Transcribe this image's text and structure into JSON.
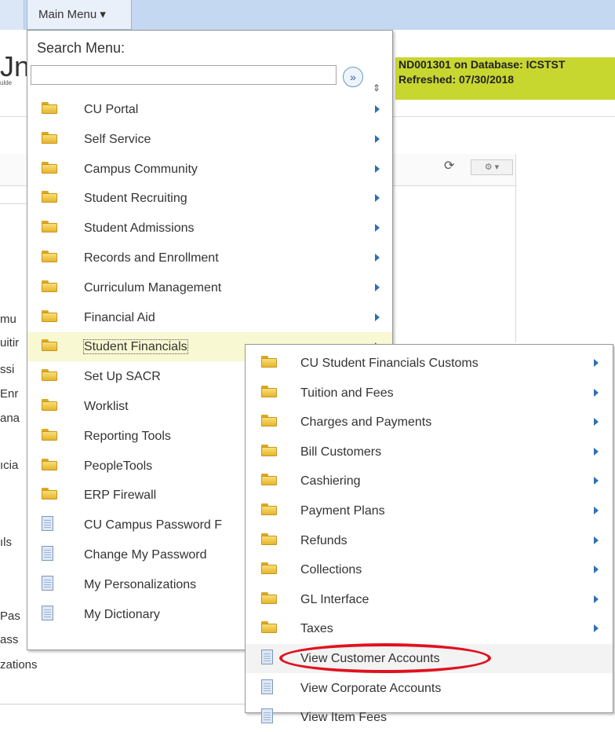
{
  "topbar": {
    "main_menu_label": "Main Menu ▾"
  },
  "background": {
    "title_fragment": "Jn",
    "subtitle_fragment": "ulde",
    "env_line1": "ND001301 on Database: ICSTST",
    "env_line2": "Refreshed: 07/30/2018",
    "refresh_icon": "⟳",
    "gear_icon": "⚙ ▾",
    "left_fragments": [
      "mu",
      "uitir",
      "ssi",
      "Enr",
      "ana",
      "ıcia",
      "",
      "ıls",
      "Pas",
      "ass",
      "zations"
    ]
  },
  "menu": {
    "search_label": "Search Menu:",
    "search_value": "",
    "go_icon": "»",
    "sort_icon": "⇕",
    "items": [
      {
        "label": "CU Portal",
        "icon": "folder",
        "arrow": true
      },
      {
        "label": "Self Service",
        "icon": "folder",
        "arrow": true
      },
      {
        "label": "Campus Community",
        "icon": "folder",
        "arrow": true
      },
      {
        "label": "Student Recruiting",
        "icon": "folder",
        "arrow": true
      },
      {
        "label": "Student Admissions",
        "icon": "folder",
        "arrow": true
      },
      {
        "label": "Records and Enrollment",
        "icon": "folder",
        "arrow": true
      },
      {
        "label": "Curriculum Management",
        "icon": "folder",
        "arrow": true
      },
      {
        "label": "Financial Aid",
        "icon": "folder",
        "arrow": true
      },
      {
        "label": "Student Financials",
        "icon": "folder",
        "arrow": true,
        "selected": true
      },
      {
        "label": "Set Up SACR",
        "icon": "folder",
        "arrow": false
      },
      {
        "label": "Worklist",
        "icon": "folder",
        "arrow": false
      },
      {
        "label": "Reporting Tools",
        "icon": "folder",
        "arrow": false
      },
      {
        "label": "PeopleTools",
        "icon": "folder",
        "arrow": false
      },
      {
        "label": "ERP Firewall",
        "icon": "folder",
        "arrow": false
      },
      {
        "label": "CU Campus Password F",
        "icon": "document",
        "arrow": false
      },
      {
        "label": "Change My Password",
        "icon": "document",
        "arrow": false
      },
      {
        "label": "My Personalizations",
        "icon": "document",
        "arrow": false
      },
      {
        "label": "My Dictionary",
        "icon": "document",
        "arrow": false
      }
    ]
  },
  "submenu": {
    "items": [
      {
        "label": "CU Student Financials Customs",
        "icon": "folder",
        "arrow": true
      },
      {
        "label": "Tuition and Fees",
        "icon": "folder",
        "arrow": true
      },
      {
        "label": "Charges and Payments",
        "icon": "folder",
        "arrow": true
      },
      {
        "label": "Bill Customers",
        "icon": "folder",
        "arrow": true
      },
      {
        "label": "Cashiering",
        "icon": "folder",
        "arrow": true
      },
      {
        "label": "Payment Plans",
        "icon": "folder",
        "arrow": true
      },
      {
        "label": "Refunds",
        "icon": "folder",
        "arrow": true
      },
      {
        "label": "Collections",
        "icon": "folder",
        "arrow": true
      },
      {
        "label": "GL Interface",
        "icon": "folder",
        "arrow": true
      },
      {
        "label": "Taxes",
        "icon": "folder",
        "arrow": true
      },
      {
        "label": "View Customer Accounts",
        "icon": "document",
        "arrow": false,
        "circled": true
      },
      {
        "label": "View Corporate Accounts",
        "icon": "document",
        "arrow": false
      },
      {
        "label": "View Item Fees",
        "icon": "document",
        "arrow": false
      }
    ]
  },
  "colors": {
    "env_bar": "#c8d630",
    "highlight_circle": "#e0121e",
    "arrow": "#2e6fb5",
    "topbar": "#c5d8f2"
  }
}
